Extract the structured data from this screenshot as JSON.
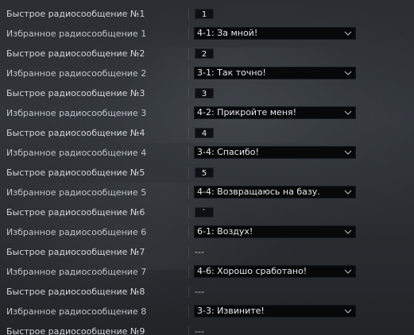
{
  "rows": [
    {
      "type": "quick",
      "label": "Быстрое радиосообщение №1",
      "key": "1"
    },
    {
      "type": "fav",
      "label": "Избранное радиосообщение 1",
      "value": "4-1: За мной!"
    },
    {
      "type": "quick",
      "label": "Быстрое радиосообщение №2",
      "key": "2"
    },
    {
      "type": "fav",
      "label": "Избранное радиосообщение 2",
      "value": "3-1: Так точно!"
    },
    {
      "type": "quick",
      "label": "Быстрое радиосообщение №3",
      "key": "3"
    },
    {
      "type": "fav",
      "label": "Избранное радиосообщение 3",
      "value": "4-2: Прикройте меня!"
    },
    {
      "type": "quick",
      "label": "Быстрое радиосообщение №4",
      "key": "4"
    },
    {
      "type": "fav",
      "label": "Избранное радиосообщение 4",
      "value": "3-4: Спасибо!"
    },
    {
      "type": "quick",
      "label": "Быстрое радиосообщение №5",
      "key": "5"
    },
    {
      "type": "fav",
      "label": "Избранное радиосообщение 5",
      "value": "4-4: Возвращаюсь на базу."
    },
    {
      "type": "quick",
      "label": "Быстрое радиосообщение №6",
      "key": "`"
    },
    {
      "type": "fav",
      "label": "Избранное радиосообщение 6",
      "value": "6-1: Воздух!"
    },
    {
      "type": "quick",
      "label": "Быстрое радиосообщение №7",
      "key": "---",
      "unassigned": true
    },
    {
      "type": "fav",
      "label": "Избранное радиосообщение 7",
      "value": "4-6: Хорошо сработано!"
    },
    {
      "type": "quick",
      "label": "Быстрое радиосообщение №8",
      "key": "---",
      "unassigned": true
    },
    {
      "type": "fav",
      "label": "Избранное радиосообщение 8",
      "value": "3-3: Извините!"
    },
    {
      "type": "quick",
      "label": "Быстрое радиосообщение №9",
      "key": "---",
      "unassigned": true
    }
  ],
  "icons": {
    "dropdown": "chevron-down-icon"
  },
  "colors": {
    "field_bg": "#06080a",
    "text": "#c7ccd1"
  }
}
